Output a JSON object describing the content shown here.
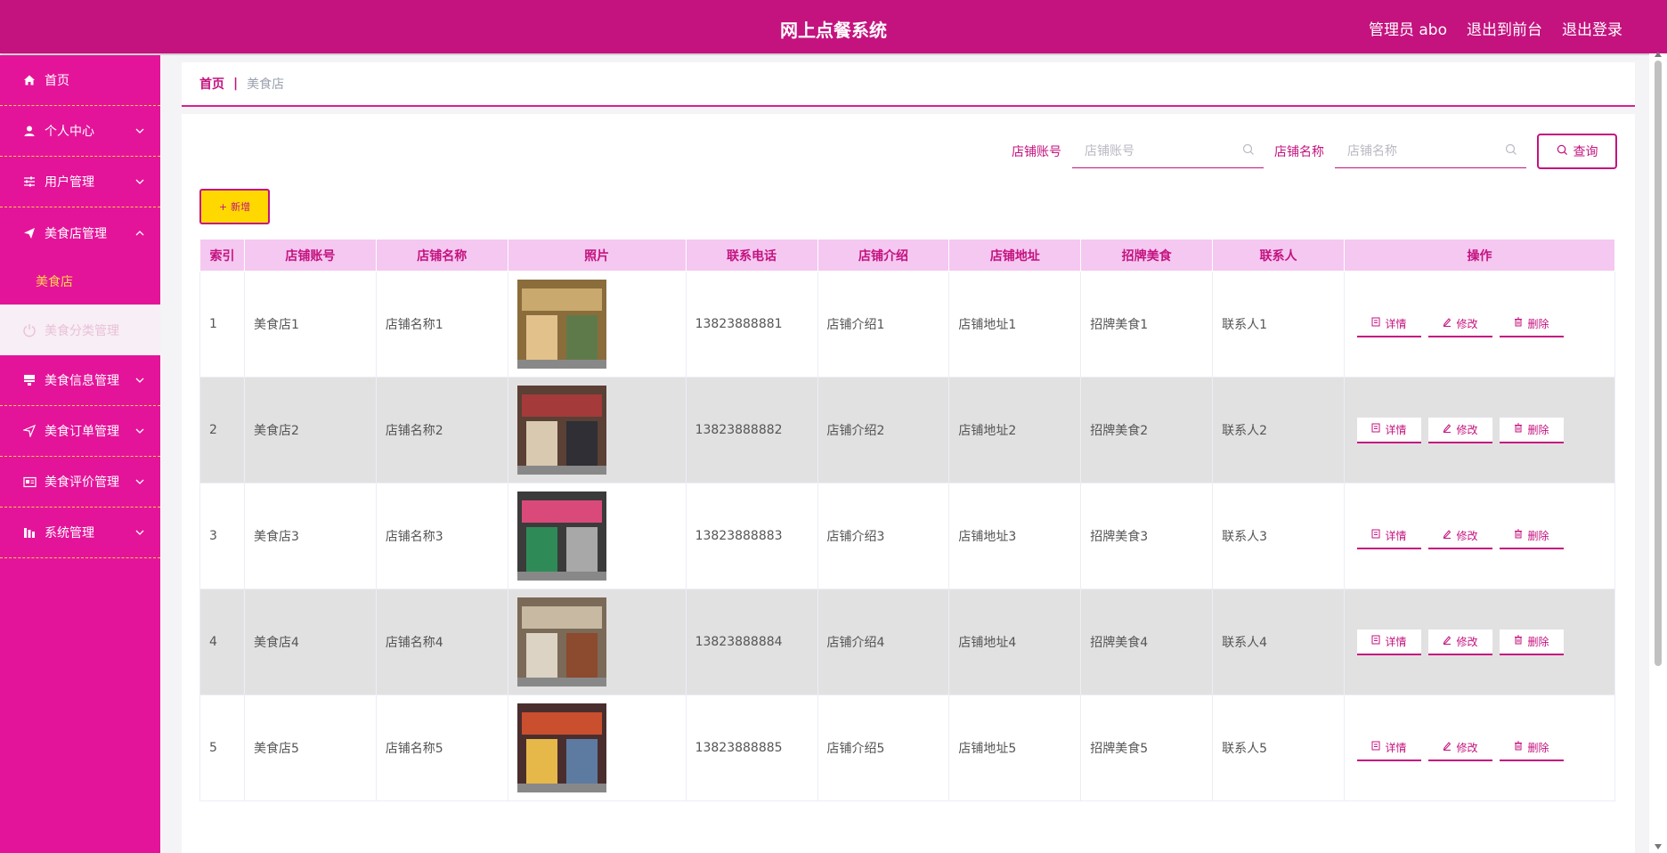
{
  "header": {
    "title": "网上点餐系统",
    "admin": "管理员 abo",
    "to_front": "退出到前台",
    "logout": "退出登录"
  },
  "sidebar": {
    "items": [
      {
        "label": "首页",
        "icon": "home-icon",
        "chevron": false
      },
      {
        "label": "个人中心",
        "icon": "user-icon",
        "chevron": true
      },
      {
        "label": "用户管理",
        "icon": "sliders-icon",
        "chevron": true
      },
      {
        "label": "美食店管理",
        "icon": "send-icon",
        "chevron": true,
        "expanded": true
      },
      {
        "label": "美食信息管理",
        "icon": "flag-icon",
        "chevron": true
      },
      {
        "label": "美食订单管理",
        "icon": "navigation-icon",
        "chevron": true
      },
      {
        "label": "美食评价管理",
        "icon": "card-icon",
        "chevron": true
      },
      {
        "label": "系统管理",
        "icon": "chart-icon",
        "chevron": true
      }
    ],
    "submenu_label": "美食店",
    "faded_label": "美食分类管理"
  },
  "breadcrumb": {
    "home": "首页",
    "separator": "|",
    "current": "美食店"
  },
  "search": {
    "account_label": "店铺账号",
    "account_placeholder": "店铺账号",
    "name_label": "店铺名称",
    "name_placeholder": "店铺名称",
    "query_label": "查询"
  },
  "add_label": "新增",
  "table": {
    "headers": [
      "索引",
      "店铺账号",
      "店铺名称",
      "照片",
      "联系电话",
      "店铺介绍",
      "店铺地址",
      "招牌美食",
      "联系人",
      "操作"
    ],
    "rows": [
      {
        "index": "1",
        "account": "美食店1",
        "name": "店铺名称1",
        "phone": "13823888881",
        "intro": "店铺介绍1",
        "address": "店铺地址1",
        "food": "招牌美食1",
        "contact": "联系人1"
      },
      {
        "index": "2",
        "account": "美食店2",
        "name": "店铺名称2",
        "phone": "13823888882",
        "intro": "店铺介绍2",
        "address": "店铺地址2",
        "food": "招牌美食2",
        "contact": "联系人2"
      },
      {
        "index": "3",
        "account": "美食店3",
        "name": "店铺名称3",
        "phone": "13823888883",
        "intro": "店铺介绍3",
        "address": "店铺地址3",
        "food": "招牌美食3",
        "contact": "联系人3"
      },
      {
        "index": "4",
        "account": "美食店4",
        "name": "店铺名称4",
        "phone": "13823888884",
        "intro": "店铺介绍4",
        "address": "店铺地址4",
        "food": "招牌美食4",
        "contact": "联系人4"
      },
      {
        "index": "5",
        "account": "美食店5",
        "name": "店铺名称5",
        "phone": "13823888885",
        "intro": "店铺介绍5",
        "address": "店铺地址5",
        "food": "招牌美食5",
        "contact": "联系人5"
      }
    ],
    "actions": {
      "detail": "详情",
      "edit": "修改",
      "delete": "删除"
    }
  },
  "colors": {
    "header_bg": "#c4137f",
    "sidebar_bg": "#e4149a",
    "accent": "#c4137f",
    "add_button": "#ffd800",
    "table_header_bg": "#f4c8f1",
    "alt_row": "#e2e1e2"
  }
}
